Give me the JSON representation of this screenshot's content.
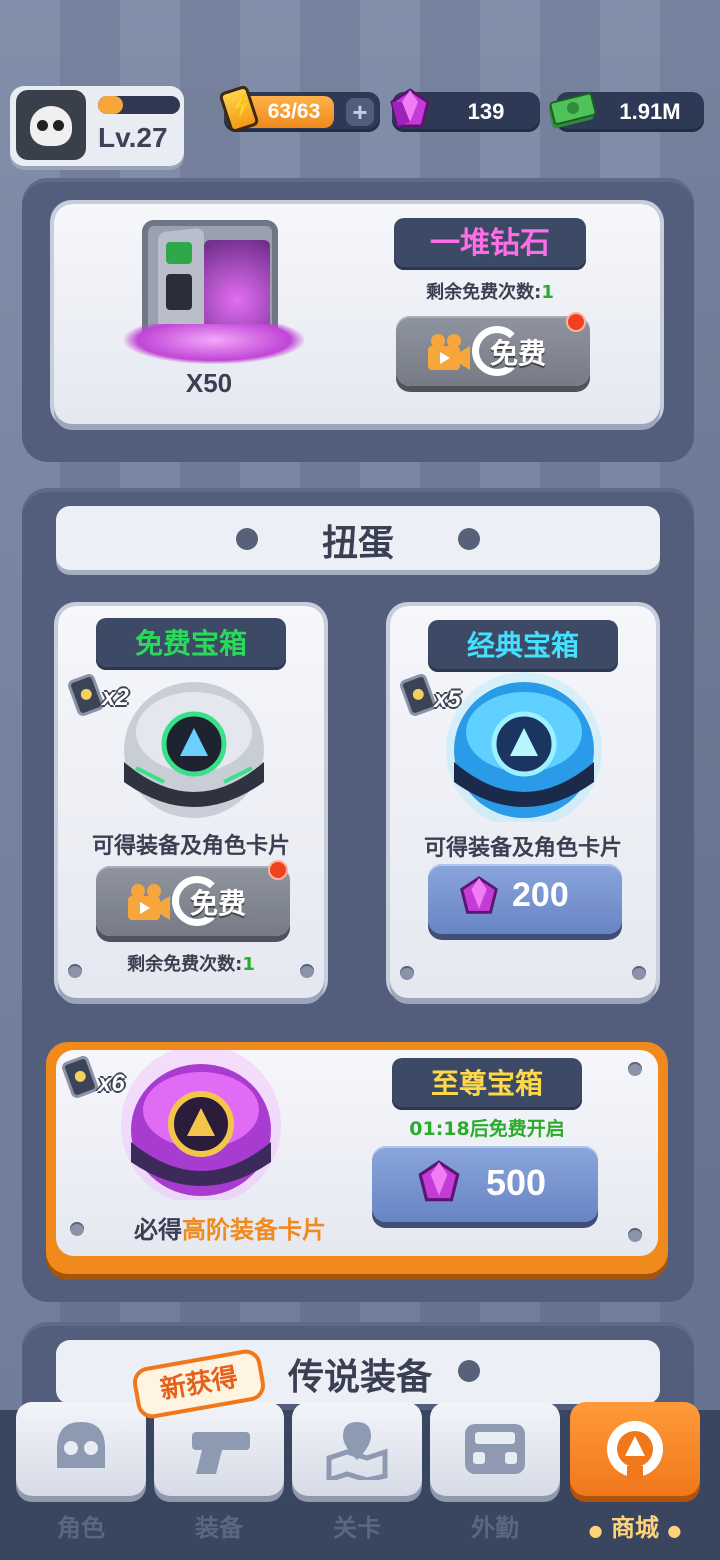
{
  "player": {
    "level": "Lv.27",
    "level_progress": 0.3
  },
  "resources": {
    "energy": "63/63",
    "gems": "139",
    "cash": "1.91M"
  },
  "free_gems": {
    "title": "一堆钻石",
    "amount": "X50",
    "remaining_label": "剩余免费次数:",
    "remaining_count": "1",
    "button_label": "免费"
  },
  "gacha": {
    "header": "扭蛋",
    "free_box": {
      "title": "免费宝箱",
      "keys": "x2",
      "desc": "可得装备及角色卡片",
      "button_label": "免费",
      "remaining_label": "剩余免费次数:",
      "remaining_count": "1"
    },
    "classic_box": {
      "title": "经典宝箱",
      "keys": "x5",
      "desc": "可得装备及角色卡片",
      "price": "200"
    },
    "supreme_box": {
      "title": "至尊宝箱",
      "keys": "x6",
      "timer": "01:18后免费开启",
      "desc_prefix": "必得",
      "desc_highlight": "高阶装备卡片",
      "price": "500"
    }
  },
  "legend_section": {
    "header": "传说装备"
  },
  "nav": {
    "new_badge": "新获得",
    "items": [
      {
        "label": "角色",
        "icon": "skull-icon"
      },
      {
        "label": "装备",
        "icon": "gun-icon"
      },
      {
        "label": "关卡",
        "icon": "map-pin-icon"
      },
      {
        "label": "外勤",
        "icon": "vehicle-icon"
      },
      {
        "label": "商城",
        "icon": "shop-icon"
      }
    ],
    "active_index": 4
  },
  "colors": {
    "accent_orange": "#f0781b",
    "free_title_green": "#2bd95a",
    "classic_title_cyan": "#45e0ff",
    "supreme_title_yellow": "#ffd84a",
    "gem_title_pink": "#ff6ee6",
    "highlight_orange": "#f08a1c"
  }
}
